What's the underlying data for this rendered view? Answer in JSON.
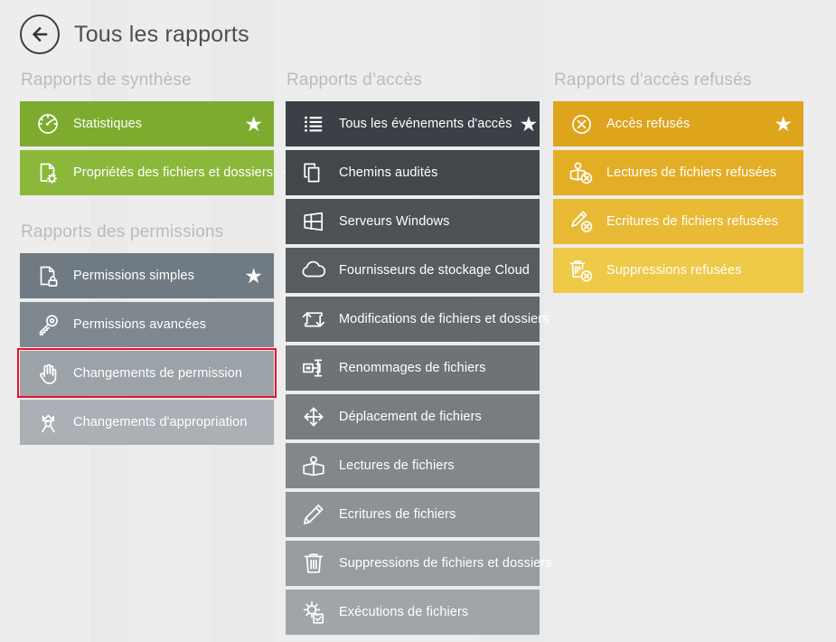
{
  "header": {
    "back_icon": "back-arrow-icon",
    "title": "Tous les rapports"
  },
  "columns": [
    {
      "id": "column-left",
      "groups": [
        {
          "id": "group-synthese",
          "title": "Rapports de synthèse",
          "items": [
            {
              "label": "Statistiques",
              "icon": "speedometer-icon",
              "shade": "g-0",
              "starred": true,
              "selected": false
            },
            {
              "label": "Propriétés des fichiers et dossiers",
              "icon": "file-gear-icon",
              "shade": "g-1",
              "starred": true,
              "selected": false
            }
          ]
        },
        {
          "id": "group-permissions",
          "title": "Rapports des permissions",
          "items": [
            {
              "label": "Permissions simples",
              "icon": "file-lock-icon",
              "shade": "p-0",
              "starred": true,
              "selected": false
            },
            {
              "label": "Permissions avancées",
              "icon": "key-icon",
              "shade": "p-1",
              "starred": false,
              "selected": false
            },
            {
              "label": "Changements de permission",
              "icon": "hand-icon",
              "shade": "p-2",
              "starred": false,
              "selected": true
            },
            {
              "label": "Changements d'appropriation",
              "icon": "crown-person-icon",
              "shade": "p-3",
              "starred": false,
              "selected": false
            }
          ]
        }
      ]
    },
    {
      "id": "column-middle",
      "groups": [
        {
          "id": "group-acces",
          "title": "Rapports d’accès",
          "items": [
            {
              "label": "Tous les événements d'accès",
              "icon": "list-icon",
              "shade": "s-0",
              "starred": true,
              "selected": false
            },
            {
              "label": "Chemins audités",
              "icon": "copy-documents-icon",
              "shade": "s-1",
              "starred": false,
              "selected": false
            },
            {
              "label": "Serveurs Windows",
              "icon": "windows-icon",
              "shade": "s-2",
              "starred": false,
              "selected": false
            },
            {
              "label": "Fournisseurs de stockage Cloud",
              "icon": "cloud-icon",
              "shade": "s-3",
              "starred": false,
              "selected": false
            },
            {
              "label": "Modifications de fichiers et dossiers",
              "icon": "modify-arrows-icon",
              "shade": "s-4",
              "starred": false,
              "selected": false
            },
            {
              "label": "Renommages de fichiers",
              "icon": "rename-icon",
              "shade": "s-5",
              "starred": false,
              "selected": false
            },
            {
              "label": "Déplacement de fichiers",
              "icon": "move-arrows-icon",
              "shade": "s-6",
              "starred": false,
              "selected": false
            },
            {
              "label": "Lectures de fichiers",
              "icon": "open-book-icon",
              "shade": "s-7",
              "starred": false,
              "selected": false
            },
            {
              "label": "Ecritures de fichiers",
              "icon": "pencil-icon",
              "shade": "s-8",
              "starred": false,
              "selected": false
            },
            {
              "label": "Suppressions de fichiers et dossiers",
              "icon": "trash-icon",
              "shade": "s-9",
              "starred": false,
              "selected": false
            },
            {
              "label": "Exécutions de fichiers",
              "icon": "gear-check-icon",
              "shade": "s-10",
              "starred": false,
              "selected": false
            }
          ]
        }
      ]
    },
    {
      "id": "column-right",
      "groups": [
        {
          "id": "group-acces-refuses",
          "title": "Rapports d'accès refusés",
          "items": [
            {
              "label": "Accès refusés",
              "icon": "denied-circle-icon",
              "shade": "a-0",
              "starred": true,
              "selected": false
            },
            {
              "label": "Lectures de fichiers refusées",
              "icon": "read-denied-icon",
              "shade": "a-1",
              "starred": false,
              "selected": false
            },
            {
              "label": "Ecritures de fichiers refusées",
              "icon": "write-denied-icon",
              "shade": "a-2",
              "starred": false,
              "selected": false
            },
            {
              "label": "Suppressions refusées",
              "icon": "delete-denied-icon",
              "shade": "a-3",
              "starred": false,
              "selected": false
            }
          ]
        }
      ]
    }
  ],
  "colors": {
    "background": "#ededed",
    "green_dark": "#7cab2e",
    "green_light": "#8bb83b",
    "charcoal": "#3a4045",
    "grey_light": "#a0a5a9",
    "amber_dark": "#dda41c",
    "amber_light": "#efc948",
    "selection_red": "#e8112d",
    "title_text": "#4a4f54",
    "group_title_text": "#b9bcbd"
  },
  "star_glyph": "★"
}
